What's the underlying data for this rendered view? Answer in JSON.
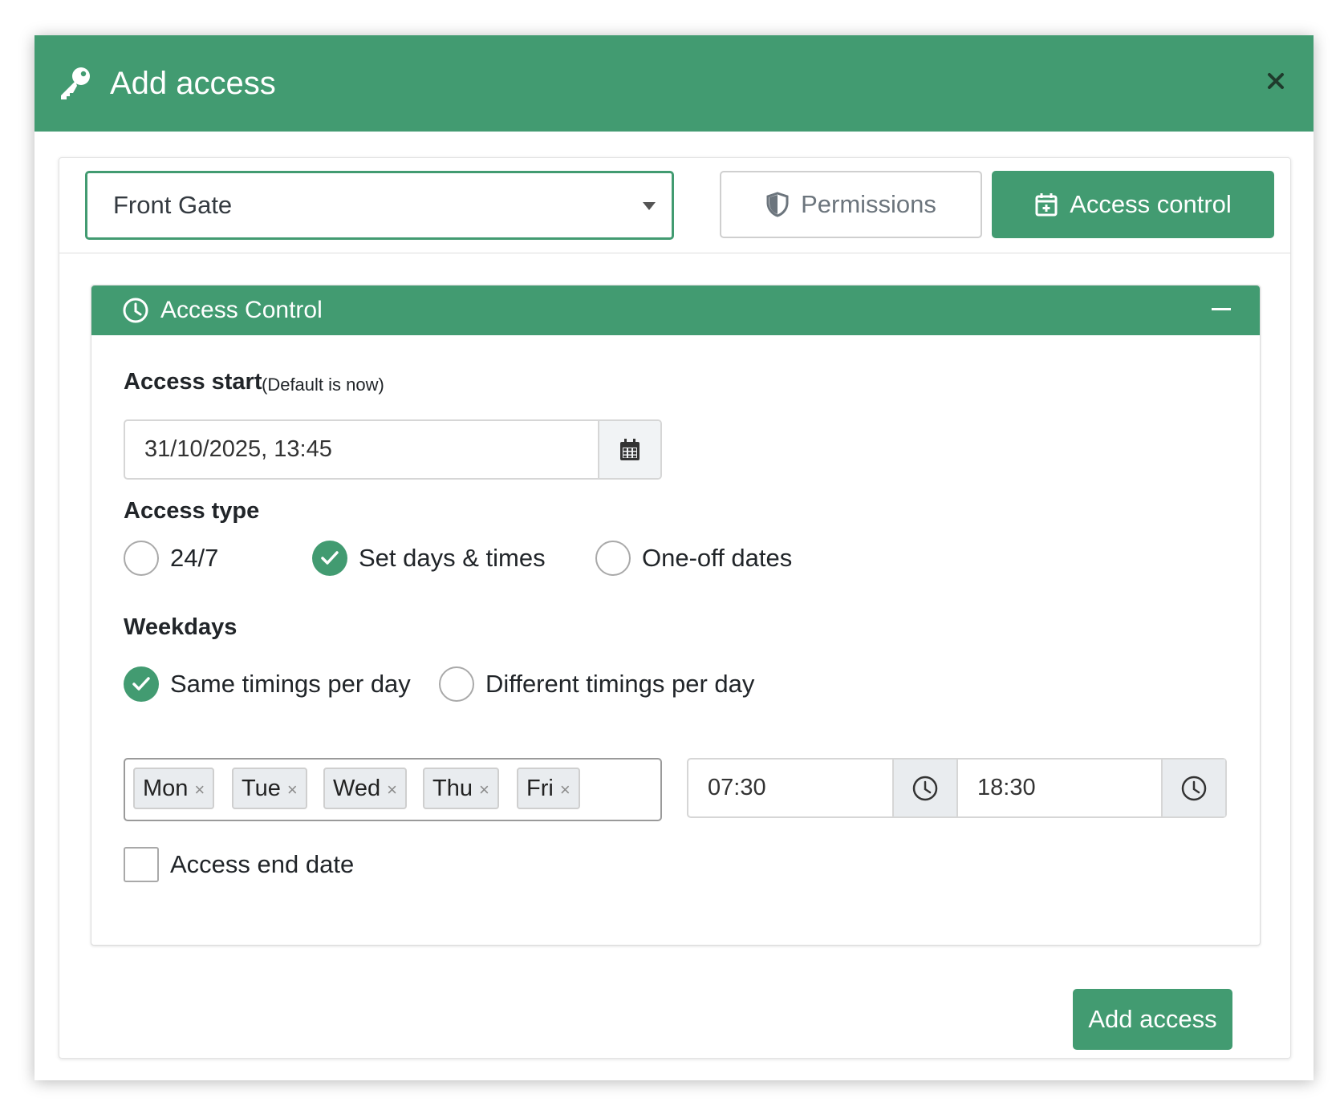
{
  "modal": {
    "title": "Add access",
    "close_label": "×",
    "icons": {
      "title_icon": "key-icon",
      "close_icon": "close-icon"
    }
  },
  "selector": {
    "selected_site": "Front Gate"
  },
  "tabs": [
    {
      "label": "Permissions",
      "icon": "shield-icon",
      "active": false
    },
    {
      "label": "Access control",
      "icon": "calendar-plus-icon",
      "active": true
    }
  ],
  "access_control": {
    "title": "Access Control",
    "icon": "clock-icon",
    "access_start_label": "Access start",
    "access_start_note": "(Default is now)",
    "access_start_value": "31/10/2025, 13:45",
    "access_type_label": "Access type",
    "access_type_options": [
      {
        "label": "24/7",
        "checked": false
      },
      {
        "label": "Set days & times",
        "checked": true
      },
      {
        "label": "One-off dates",
        "checked": false
      }
    ],
    "weekdays_label": "Weekdays",
    "timing_options": [
      {
        "label": "Same timings per day",
        "checked": true
      },
      {
        "label": "Different timings per day",
        "checked": false
      }
    ],
    "days": [
      "Mon",
      "Tue",
      "Wed",
      "Thu",
      "Fri"
    ],
    "day_remove_glyph": "×",
    "start_time": "07:30",
    "end_time": "18:30",
    "end_date_label": "Access end date",
    "end_date_checked": false
  },
  "footer": {
    "add_button_label": "Add access"
  },
  "colors": {
    "brand_green": "#429b71",
    "addon_grey": "#e9ecef"
  }
}
